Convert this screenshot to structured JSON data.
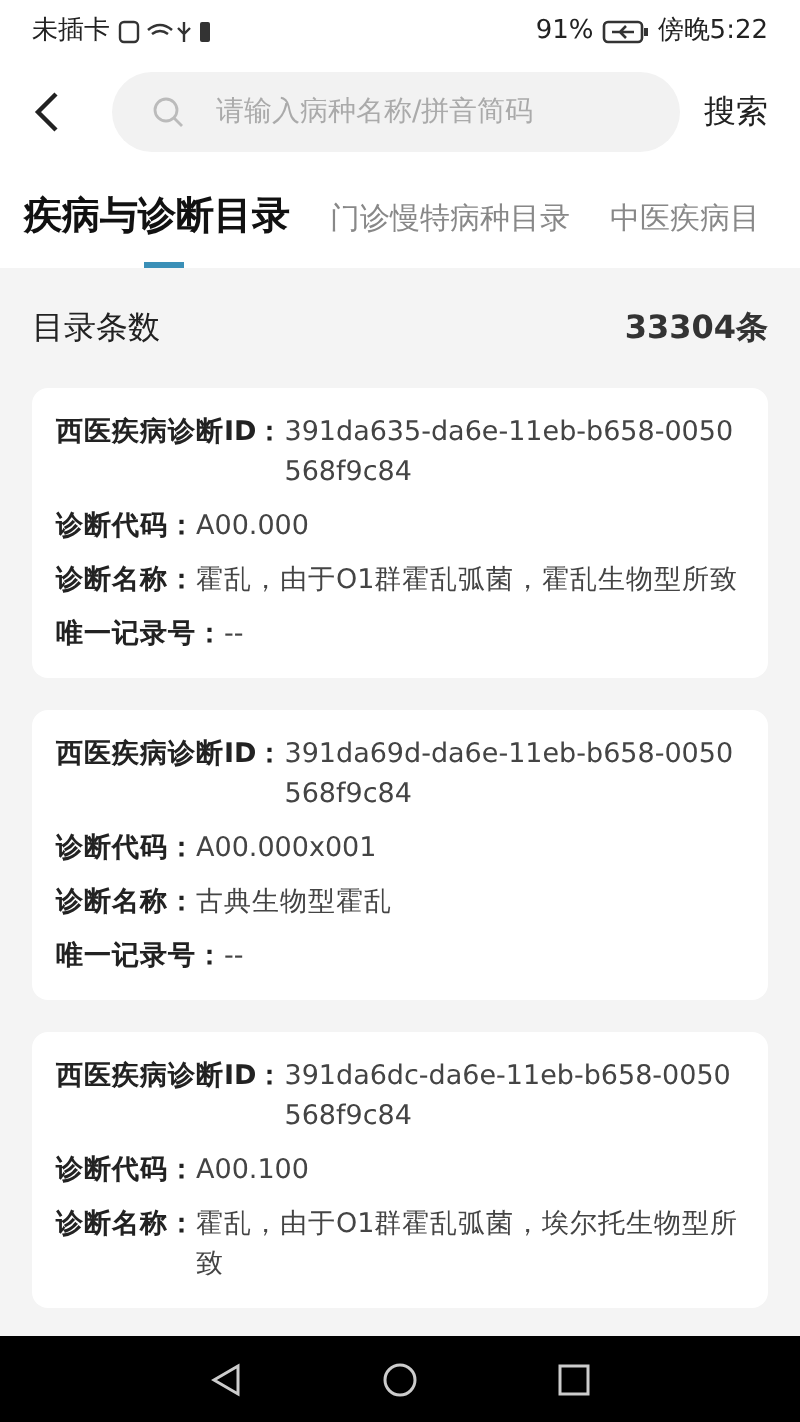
{
  "status_bar": {
    "carrier": "未插卡",
    "battery": "91%",
    "time": "傍晚5:22"
  },
  "search": {
    "placeholder": "请输入病种名称/拼音简码",
    "button": "搜索"
  },
  "tabs": [
    {
      "label": "疾病与诊断目录",
      "selected": true
    },
    {
      "label": "门诊慢特病种目录",
      "selected": false
    },
    {
      "label": "中医疾病目",
      "selected": false
    }
  ],
  "summary": {
    "label": "目录条数",
    "count": "33304条"
  },
  "records": [
    {
      "fields": [
        {
          "label": "西医疾病诊断ID：",
          "value": "391da635-da6e-11eb-b658-0050568f9c84"
        },
        {
          "label": "诊断代码：",
          "value": "A00.000"
        },
        {
          "label": "诊断名称：",
          "value": "霍乱，由于O1群霍乱弧菌，霍乱生物型所致"
        },
        {
          "label": "唯一记录号：",
          "value": "--"
        }
      ]
    },
    {
      "fields": [
        {
          "label": "西医疾病诊断ID：",
          "value": "391da69d-da6e-11eb-b658-0050568f9c84"
        },
        {
          "label": "诊断代码：",
          "value": "A00.000x001"
        },
        {
          "label": "诊断名称：",
          "value": "古典生物型霍乱"
        },
        {
          "label": "唯一记录号：",
          "value": "--"
        }
      ]
    },
    {
      "fields": [
        {
          "label": "西医疾病诊断ID：",
          "value": "391da6dc-da6e-11eb-b658-0050568f9c84"
        },
        {
          "label": "诊断代码：",
          "value": "A00.100"
        },
        {
          "label": "诊断名称：",
          "value": "霍乱，由于O1群霍乱弧菌，埃尔托生物型所致"
        }
      ]
    }
  ]
}
